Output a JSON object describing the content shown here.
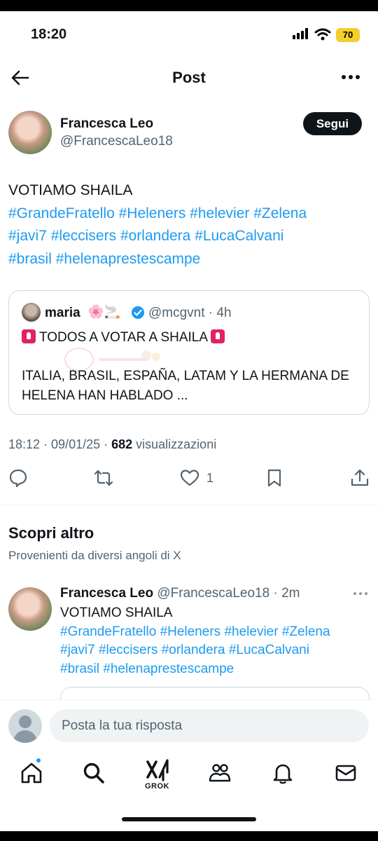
{
  "status_bar": {
    "time": "18:20",
    "battery": "70"
  },
  "header": {
    "title": "Post"
  },
  "post": {
    "author_name": "Francesca Leo",
    "author_handle": "@FrancescaLeo18",
    "follow_label": "Segui",
    "text_line": "VOTIAMO SHAILA",
    "hashtags": [
      "#GrandeFratello",
      "#Heleners",
      "#helevier",
      "#Zelena",
      "#javi7",
      "#leccisers",
      "#orlandera",
      "#LucaCalvani",
      "#brasil",
      "#helenaprestescampe"
    ],
    "timestamp": "18:12 · 09/01/25 · ",
    "views_count": "682",
    "views_label": " visualizzazioni",
    "like_count": "1"
  },
  "quoted": {
    "name": "maria",
    "emoji": "🌸🚬",
    "handle_time": "@mcgvnt · 4h",
    "line1": "TODOS A VOTAR A SHAILA",
    "line2": "ITALIA, BRASIL, ESPAÑA, LATAM Y LA HERMANA DE HELENA HAN HABLADO ..."
  },
  "discover": {
    "title": "Scopri altro",
    "subtitle": "Provenienti da diversi angoli di X"
  },
  "recommended": {
    "name": "Francesca Leo",
    "handle_time": "@FrancescaLeo18 · 2m",
    "text_line": "VOTIAMO SHAILA"
  },
  "composer": {
    "placeholder": "Posta la tua risposta"
  },
  "tabbar": {
    "grok_label": "GROK"
  },
  "colors": {
    "link": "#1d9bf0",
    "text": "#0f1419",
    "secondary": "#536471",
    "battery": "#f4cf2b"
  }
}
